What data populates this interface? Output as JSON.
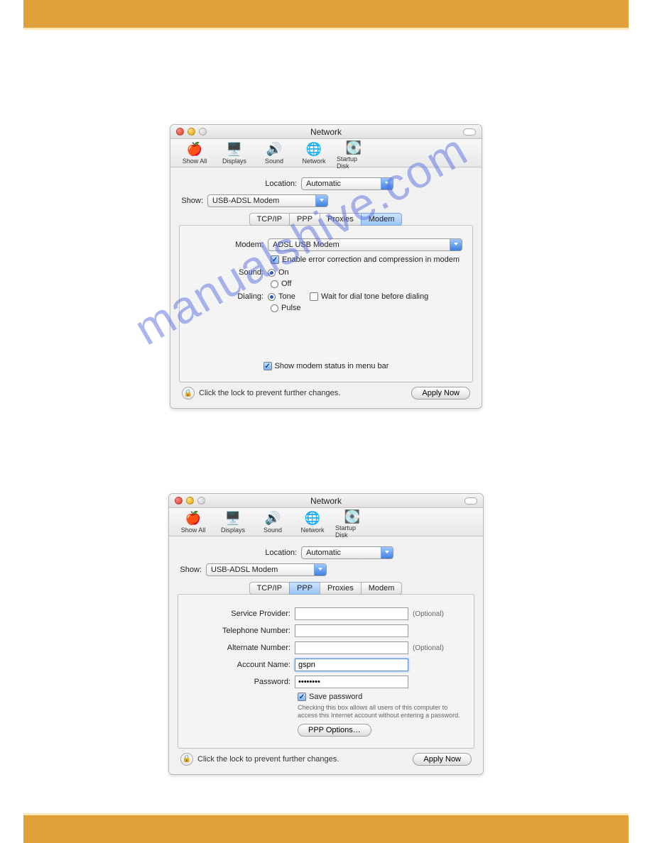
{
  "watermark": "manualshive.com",
  "window1": {
    "title": "Network",
    "tools": [
      "Show All",
      "Displays",
      "Sound",
      "Network",
      "Startup Disk"
    ],
    "location_label": "Location:",
    "location_value": "Automatic",
    "show_label": "Show:",
    "show_value": "USB-ADSL Modem",
    "tabs": [
      "TCP/IP",
      "PPP",
      "Proxies",
      "Modem"
    ],
    "modem_label": "Modem:",
    "modem_value": "ADSL USB Modem",
    "enable_ec": "Enable error correction and compression in modem",
    "sound_label": "Sound:",
    "sound_on": "On",
    "sound_off": "Off",
    "dialing_label": "Dialing:",
    "dialing_tone": "Tone",
    "dialing_pulse": "Pulse",
    "wait_label": "Wait for dial tone before dialing",
    "show_status": "Show modem status in menu bar",
    "lock_text": "Click the lock to prevent further changes.",
    "apply": "Apply Now"
  },
  "window2": {
    "title": "Network",
    "tools": [
      "Show All",
      "Displays",
      "Sound",
      "Network",
      "Startup Disk"
    ],
    "location_label": "Location:",
    "location_value": "Automatic",
    "show_label": "Show:",
    "show_value": "USB-ADSL Modem",
    "tabs": [
      "TCP/IP",
      "PPP",
      "Proxies",
      "Modem"
    ],
    "sp_label": "Service Provider:",
    "sp_value": "",
    "tel_label": "Telephone Number:",
    "tel_value": "",
    "alt_label": "Alternate Number:",
    "alt_value": "",
    "acct_label": "Account Name:",
    "acct_value": "gspn",
    "pwd_label": "Password:",
    "pwd_value": "••••••••",
    "optional": "(Optional)",
    "save_pwd": "Save password",
    "save_hint": "Checking this box allows all users of this computer to access this Internet account without entering a password.",
    "ppp_opts": "PPP Options…",
    "lock_text": "Click the lock to prevent further changes.",
    "apply": "Apply Now"
  }
}
